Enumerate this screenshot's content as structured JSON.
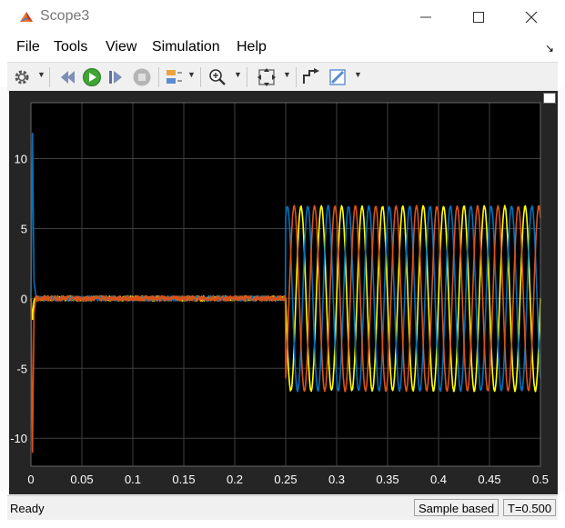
{
  "window": {
    "title": "Scope3",
    "controls": {
      "minimize": "—",
      "maximize": "☐",
      "close": "✕"
    }
  },
  "menu": {
    "items": [
      "File",
      "Tools",
      "View",
      "Simulation",
      "Help"
    ],
    "corner_arrow": "↘"
  },
  "toolbar": {
    "icons": [
      "gear-icon",
      "step-back-icon",
      "run-icon",
      "step-forward-icon",
      "stop-icon",
      "triggers-icon",
      "zoom-icon",
      "fit-icon",
      "cursor-measure-icon",
      "style-icon"
    ]
  },
  "status": {
    "state": "Ready",
    "mode": "Sample based",
    "time": "T=0.500"
  },
  "colors": {
    "background": "#000000",
    "grid": "#404040",
    "tick_text": "#ffffff",
    "phase_a": "#ffff00",
    "phase_b": "#0072bd",
    "phase_c": "#d95319"
  },
  "chart_data": {
    "type": "line",
    "xlim": [
      0,
      0.5
    ],
    "ylim": [
      -12,
      14
    ],
    "xticks": [
      0,
      0.05,
      0.1,
      0.15,
      0.2,
      0.25,
      0.3,
      0.35,
      0.4,
      0.45,
      0.5
    ],
    "xtick_labels": [
      "0",
      "0.05",
      "0.1",
      "0.15",
      "0.2",
      "0.25",
      "0.3",
      "0.35",
      "0.4",
      "0.45",
      "0.5"
    ],
    "yticks": [
      -10,
      -5,
      0,
      5,
      10
    ],
    "ytick_labels": [
      "-10",
      "-5",
      "0",
      "5",
      "10"
    ],
    "grid": true,
    "series": [
      {
        "color": "#ffff00",
        "phase_deg": 0,
        "amplitude": 6.6,
        "start_spike": -1.5
      },
      {
        "color": "#0072bd",
        "phase_deg": -120,
        "amplitude": 6.6,
        "start_spike": 11.8
      },
      {
        "color": "#d95319",
        "phase_deg": 120,
        "amplitude": 6.6,
        "start_spike": -11.0
      }
    ],
    "signal": {
      "frequency_hz": 50,
      "step_time": 0.25,
      "pre_step_level": 0
    }
  }
}
